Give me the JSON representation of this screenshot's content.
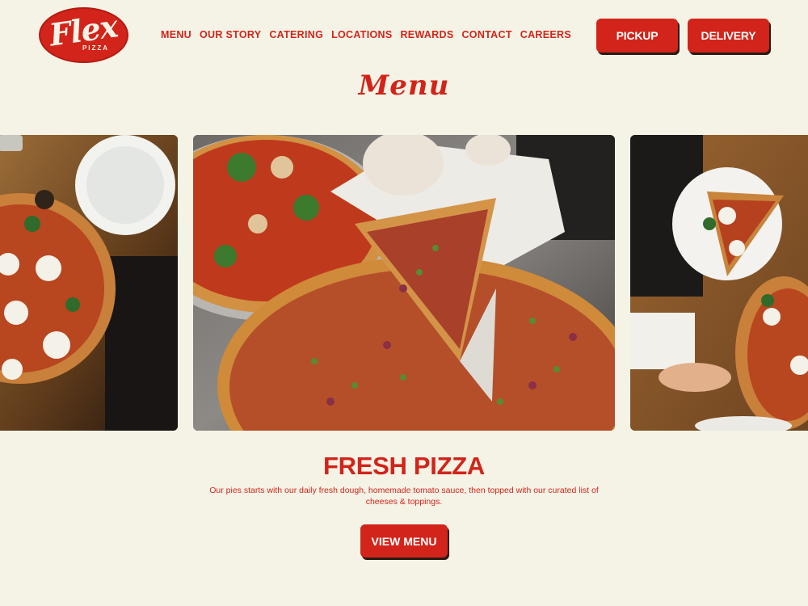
{
  "brand": {
    "logo_text": "Flex",
    "logo_sub": "PIZZA",
    "logo_color": "#d2241a"
  },
  "nav": {
    "items": [
      {
        "label": "MENU"
      },
      {
        "label": "OUR STORY"
      },
      {
        "label": "CATERING"
      },
      {
        "label": "LOCATIONS"
      },
      {
        "label": "REWARDS"
      },
      {
        "label": "CONTACT"
      },
      {
        "label": "CAREERS"
      }
    ]
  },
  "actions": {
    "pickup_label": "PICKUP",
    "delivery_label": "DELIVERY"
  },
  "section": {
    "title": "Menu"
  },
  "carousel": {
    "slides": [
      {
        "icon": "pizza-photo-icon"
      },
      {
        "icon": "pizza-photo-icon"
      },
      {
        "icon": "pizza-photo-icon"
      }
    ]
  },
  "feature": {
    "title": "FRESH PIZZA",
    "description": "Our pies starts with our daily fresh dough, homemade tomato sauce, then topped with our curated list of cheeses & toppings.",
    "cta_label": "VIEW MENU"
  },
  "colors": {
    "accent": "#d2241a",
    "background": "#f5f3e6",
    "shadow": "#2b1a14"
  }
}
